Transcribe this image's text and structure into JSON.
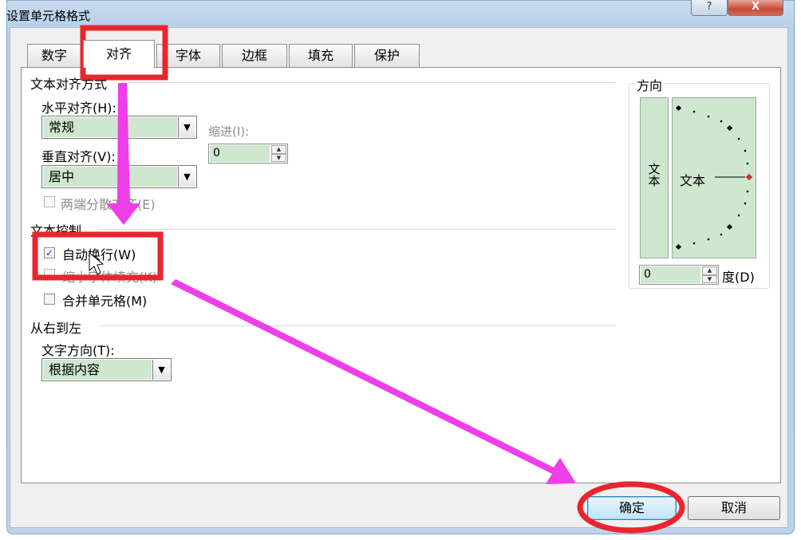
{
  "window": {
    "title": "设置单元格格式",
    "help_glyph": "?",
    "close_glyph": "X"
  },
  "tabs": [
    {
      "label": "数字",
      "active": false
    },
    {
      "label": "对齐",
      "active": true
    },
    {
      "label": "字体",
      "active": false
    },
    {
      "label": "边框",
      "active": false
    },
    {
      "label": "填充",
      "active": false
    },
    {
      "label": "保护",
      "active": false
    }
  ],
  "text_alignment": {
    "group_label": "文本对齐方式",
    "horizontal_label": "水平对齐(H):",
    "horizontal_value": "常规",
    "vertical_label": "垂直对齐(V):",
    "vertical_value": "居中",
    "indent_label": "缩进(I):",
    "indent_value": "0",
    "justify_distributed_label": "两端分散对齐(E)"
  },
  "text_control": {
    "group_label": "文本控制",
    "wrap_text_label": "自动换行(W)",
    "wrap_text_checked": true,
    "shrink_to_fit_label": "缩小字体填充(K)",
    "shrink_to_fit_checked": false,
    "merge_cells_label": "合并单元格(M)",
    "merge_cells_checked": false
  },
  "right_to_left": {
    "group_label": "从右到左",
    "direction_label": "文字方向(T):",
    "direction_value": "根据内容"
  },
  "orientation": {
    "group_label": "方向",
    "vertical_text": "文本",
    "dial_text": "文本",
    "degree_value": "0",
    "degree_label": "度(D)"
  },
  "buttons": {
    "ok": "确定",
    "cancel": "取消"
  },
  "colors": {
    "annotation": "#e8262c",
    "arrow": "#ee3ee8",
    "field_fill": "#cfe6cf"
  }
}
